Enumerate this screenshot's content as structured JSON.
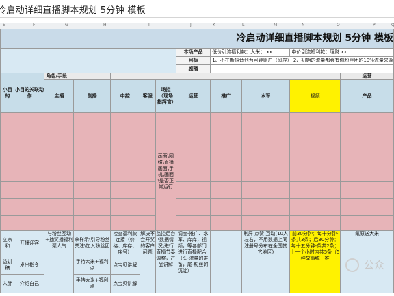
{
  "window": {
    "title": "冷启动详细直播脚本规划 5分钟 模板"
  },
  "column_letters": [
    "E",
    "F",
    "G",
    "H",
    "I",
    "J",
    "K",
    "L",
    "M",
    "N",
    "O",
    "P",
    "Q"
  ],
  "sheet": {
    "title": "冷启动详细直播脚本规划 5分钟 模板",
    "info": {
      "product_label": "本场产品",
      "product_low": "低价引流福利款：大米；",
      "product_low_val": "xx",
      "product_mid": "中价引流福利款：理财",
      "product_mid_val": "xx",
      "goal_label": "目标",
      "goal_text": "1、不在新抖音列为可疑账户（风控）   2、初始的流量都会有你粉丝团的10%流量来源",
      "script_label": "剧播"
    },
    "headers": {
      "role_group": "角色/手段",
      "col_goal": "小目的",
      "col_action": "小目的关联动作",
      "host": "主播",
      "cohost": "副播",
      "control": "中控",
      "service": "客服",
      "scene": "场控（现场指挥官）",
      "ops": "运营",
      "promo": "推广",
      "water": "水军",
      "video": "视频",
      "ops2": "运营",
      "product": "产品"
    },
    "scene_text": "画面\\网络\\直播画面\\手机\\画面\\是否正常运行",
    "rows": [
      {
        "goal": "立宗和",
        "action": "开播迎客",
        "host": "与粉丝互动+抽奖播福利聚人气",
        "cohost": "拿样示\\引导粉丝关注\\加入粉丝团",
        "control": "检查福利款连接（价格、库存、序号）",
        "service": "解决不会开奖的客户问题",
        "scene": "监控后台\\数据情况\\进行直播节奏调整，产品讲解",
        "ops": "调度-推广、水军、库库，视频，等各部门进行直播配合（头-流量的准备，尾-粉丝的沉淀）",
        "water": "刷屏 点赞 互动(10人左右，不用数据上同注册号分布在全国其它地区)",
        "video": "前30分钟：每十分钟-条共3条；后30分钟：每十五分钟-条共2条；上一个小时内共5条（5 种故事统一推",
        "product": "氟原送大米"
      },
      {
        "goal": "益讲稿",
        "action": "发出指令",
        "cohost": "手持大米+福利点",
        "control": "点宝贝讲解"
      },
      {
        "goal": "入胖",
        "action": "介绍自己",
        "cohost": "手持大米+福利点",
        "control": "点宝贝讲解"
      }
    ]
  },
  "watermark": "公众"
}
